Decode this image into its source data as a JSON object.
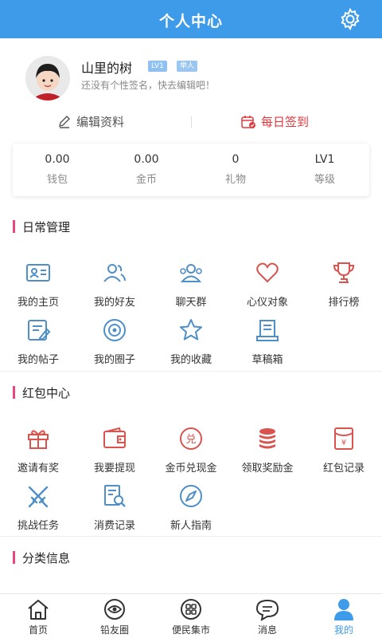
{
  "header": {
    "title": "个人中心"
  },
  "profile": {
    "name": "山里的树",
    "level_badge": "LV1",
    "role_badge": "举人",
    "signature": "还没有个性签名，快去编辑吧！"
  },
  "actions": {
    "edit_label": "编辑资料",
    "sign_label": "每日签到"
  },
  "stats": [
    {
      "value": "0.00",
      "label": "钱包"
    },
    {
      "value": "0.00",
      "label": "金币"
    },
    {
      "value": "0",
      "label": "礼物"
    },
    {
      "value": "LV1",
      "label": "等级"
    }
  ],
  "sections": {
    "daily": {
      "title": "日常管理",
      "items": [
        "我的主页",
        "我的好友",
        "聊天群",
        "心仪对象",
        "排行榜",
        "我的帖子",
        "我的圈子",
        "我的收藏",
        "草稿箱"
      ]
    },
    "redpacket": {
      "title": "红包中心",
      "items": [
        "邀请有奖",
        "我要提现",
        "金币兑现金",
        "领取奖励金",
        "红包记录",
        "挑战任务",
        "消费记录",
        "新人指南"
      ]
    },
    "category": {
      "title": "分类信息"
    }
  },
  "tabbar": {
    "items": [
      "首页",
      "铅友圈",
      "便民集市",
      "消息",
      "我的"
    ],
    "active_index": 4
  },
  "colors": {
    "header_blue": "#3d9be9",
    "accent_red": "#e0383e",
    "section_bar": "#e8467c",
    "icon_blue": "#4f8fc8",
    "icon_red": "#d9534f"
  }
}
